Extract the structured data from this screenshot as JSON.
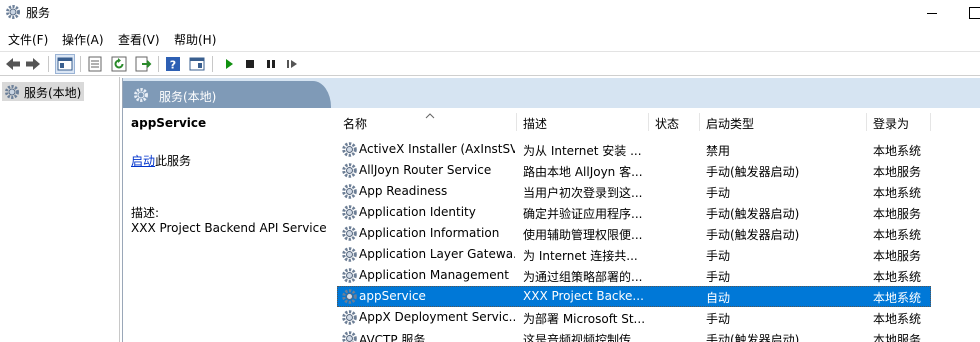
{
  "window": {
    "title": "服务"
  },
  "menu": [
    "文件(F)",
    "操作(A)",
    "查看(V)",
    "帮助(H)"
  ],
  "toolbar": {
    "buttons": [
      "back-arrow-icon",
      "forward-arrow-icon",
      "console-tree-icon",
      "properties-icon",
      "refresh-icon",
      "export-list-icon",
      "help-icon",
      "show-hide-icon",
      "play-icon",
      "stop-icon",
      "pause-icon",
      "resume-icon"
    ],
    "colors": {
      "play": "#109010",
      "stop": "#202020",
      "pause": "#202020"
    }
  },
  "tree": {
    "item": "服务(本地)"
  },
  "panel": {
    "title": "服务(本地)"
  },
  "detail": {
    "service_name": "appService",
    "start_link": "启动",
    "start_suffix": "此服务",
    "desc_label": "描述:",
    "desc_text": "XXX Project Backend API Service"
  },
  "columns": [
    "名称",
    "描述",
    "状态",
    "启动类型",
    "登录为"
  ],
  "rows": [
    {
      "name": "ActiveX Installer (AxInstSV)",
      "desc": "为从 Internet 安装 ...",
      "status": "",
      "startup": "禁用",
      "logon": "本地系统"
    },
    {
      "name": "AllJoyn Router Service",
      "desc": "路由本地 AllJoyn 客...",
      "status": "",
      "startup": "手动(触发器启动)",
      "logon": "本地服务"
    },
    {
      "name": "App Readiness",
      "desc": "当用户初次登录到这...",
      "status": "",
      "startup": "手动",
      "logon": "本地系统"
    },
    {
      "name": "Application Identity",
      "desc": "确定并验证应用程序...",
      "status": "",
      "startup": "手动(触发器启动)",
      "logon": "本地服务"
    },
    {
      "name": "Application Information",
      "desc": "使用辅助管理权限便...",
      "status": "",
      "startup": "手动(触发器启动)",
      "logon": "本地系统"
    },
    {
      "name": "Application Layer Gatewa...",
      "desc": "为 Internet 连接共...",
      "status": "",
      "startup": "手动",
      "logon": "本地服务"
    },
    {
      "name": "Application Management",
      "desc": "为通过组策略部署的...",
      "status": "",
      "startup": "手动",
      "logon": "本地系统"
    },
    {
      "name": "appService",
      "desc": "XXX Project Backe...",
      "status": "",
      "startup": "自动",
      "logon": "本地系统",
      "selected": true
    },
    {
      "name": "AppX Deployment Servic...",
      "desc": "为部署 Microsoft St...",
      "status": "",
      "startup": "手动",
      "logon": "本地系统"
    },
    {
      "name": "AVCTP 服务",
      "desc": "这是音频视频控制传...",
      "status": "",
      "startup": "手动(触发器启动)",
      "logon": "本地服务"
    }
  ],
  "colors": {
    "selection": "#0078d7",
    "header_tab": "#7f9ab7",
    "header_band": "#d6e4f2",
    "link": "#0033cc"
  }
}
